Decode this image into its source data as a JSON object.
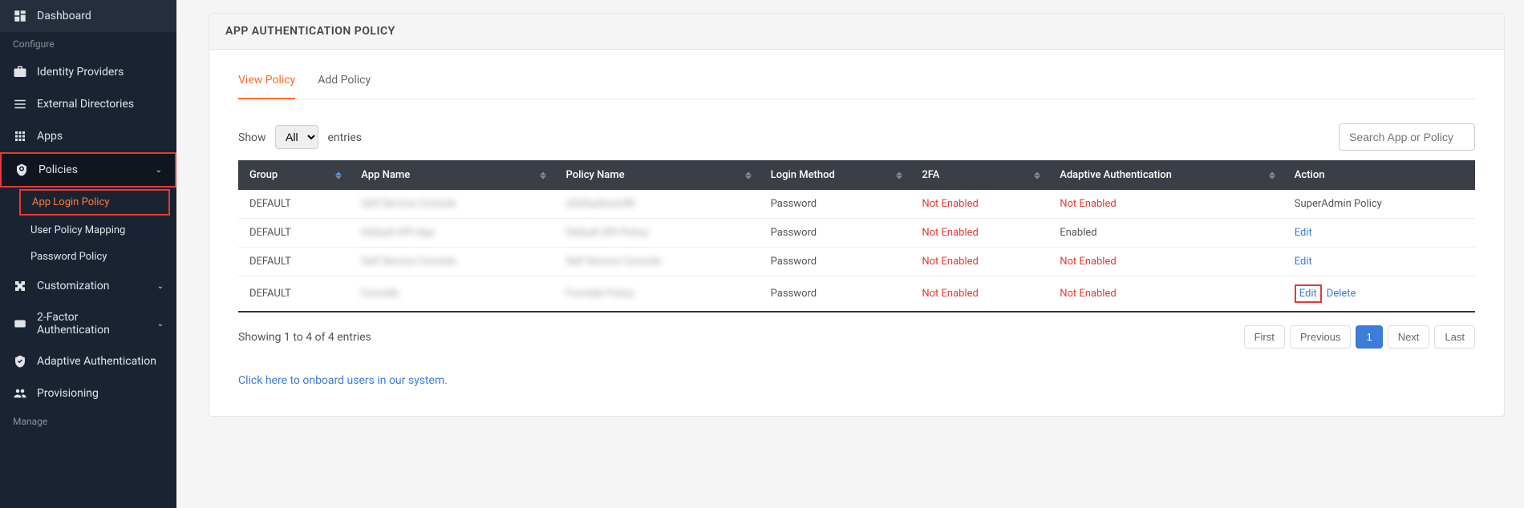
{
  "sidebar": {
    "dashboard": "Dashboard",
    "section_configure": "Configure",
    "identity_providers": "Identity Providers",
    "external_directories": "External Directories",
    "apps": "Apps",
    "policies": "Policies",
    "sub_app_login_policy": "App Login Policy",
    "sub_user_policy_mapping": "User Policy Mapping",
    "sub_password_policy": "Password Policy",
    "customization": "Customization",
    "two_factor": "2-Factor Authentication",
    "adaptive_auth": "Adaptive Authentication",
    "provisioning": "Provisioning",
    "section_manage": "Manage"
  },
  "page": {
    "title": "APP AUTHENTICATION POLICY",
    "tabs": {
      "view": "View Policy",
      "add": "Add Policy"
    },
    "show_label": "Show",
    "entries_label": "entries",
    "entries_selected": "All",
    "search_placeholder": "Search App or Policy",
    "columns": {
      "group": "Group",
      "app_name": "App Name",
      "policy_name": "Policy Name",
      "login_method": "Login Method",
      "twofa": "2FA",
      "adaptive": "Adaptive Authentication",
      "action": "Action"
    },
    "rows": [
      {
        "group": "DEFAULT",
        "app": "Self Service Console",
        "policy": "xDefaultxxxxRt",
        "login": "Password",
        "twofa": "Not Enabled",
        "adaptive": "Not Enabled",
        "action_text": "SuperAdmin Policy",
        "action_boxed": false,
        "action_delete": false
      },
      {
        "group": "DEFAULT",
        "app": "Default API App",
        "policy": "Default API Policy",
        "login": "Password",
        "twofa": "Not Enabled",
        "adaptive": "Enabled",
        "action_text": "Edit",
        "action_boxed": false,
        "action_delete": false
      },
      {
        "group": "DEFAULT",
        "app": "Self Service Console",
        "policy": "Self Service Console",
        "login": "Password",
        "twofa": "Not Enabled",
        "adaptive": "Not Enabled",
        "action_text": "Edit",
        "action_boxed": false,
        "action_delete": false
      },
      {
        "group": "DEFAULT",
        "app": "Formdlx",
        "policy": "Formdlx Policy",
        "login": "Password",
        "twofa": "Not Enabled",
        "adaptive": "Not Enabled",
        "action_text": "Edit",
        "action_boxed": true,
        "action_delete": true
      }
    ],
    "delete_label": "Delete",
    "showing_text": "Showing 1 to 4 of 4 entries",
    "pagination": {
      "first": "First",
      "previous": "Previous",
      "page1": "1",
      "next": "Next",
      "last": "Last"
    },
    "onboard_link": "Click here to onboard users in our system."
  }
}
